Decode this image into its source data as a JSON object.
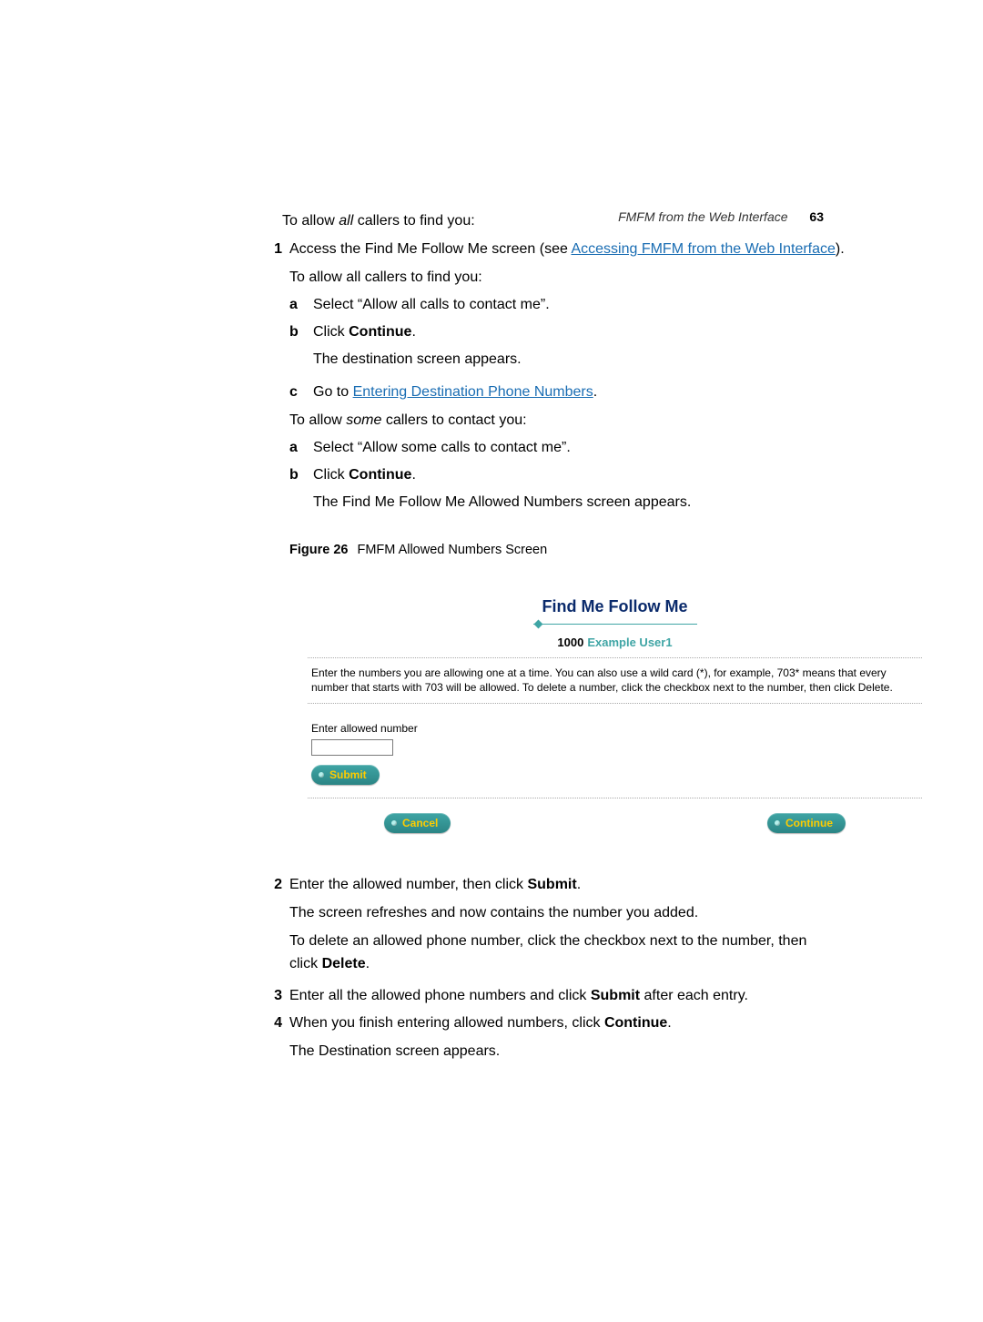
{
  "header": {
    "section": "FMFM from the Web Interface",
    "page": "63"
  },
  "intro": {
    "lead_pre": "To allow ",
    "lead_em": "all",
    "lead_post": " callers to find you:"
  },
  "step1": {
    "num": "1",
    "text_pre": "Access the Find Me Follow Me screen (see ",
    "link1": "Accessing FMFM from the Web Interface",
    "text_post": ")."
  },
  "reintro_all": "To allow all callers to find you:",
  "sub_a1": {
    "label": "a",
    "text": "Select “Allow all calls to contact me”."
  },
  "sub_b1": {
    "label": "b",
    "pre": "Click ",
    "bold": "Continue",
    "post": ".",
    "after": "The destination screen appears."
  },
  "sub_c1": {
    "label": "c",
    "pre": "Go to ",
    "link": "Entering Destination Phone Numbers",
    "post": "."
  },
  "reintro_some": {
    "pre": "To allow ",
    "em": "some",
    "post": " callers to contact you:"
  },
  "sub_a2": {
    "label": "a",
    "text": "Select “Allow some calls to contact me”."
  },
  "sub_b2": {
    "label": "b",
    "pre": "Click ",
    "bold": "Continue",
    "post": ".",
    "after": "The Find Me Follow Me Allowed Numbers screen appears."
  },
  "figure": {
    "label": "Figure 26",
    "caption": "FMFM Allowed Numbers Screen"
  },
  "ui": {
    "title": "Find Me Follow Me",
    "uid": "1000",
    "uname": "Example User1",
    "instructions": "Enter the numbers you are allowing one at a time. You can also use a wild card (*), for example, 703* means that every number that starts with 703 will be allowed. To delete a number, click the checkbox next to the number, then click Delete.",
    "field_label": "Enter allowed number",
    "input_value": "",
    "submit": "Submit",
    "cancel": "Cancel",
    "continue": "Continue"
  },
  "step2": {
    "num": "2",
    "line1_pre": "Enter the allowed number, then click ",
    "line1_bold": "Submit",
    "line1_post": ".",
    "line2": "The screen refreshes and now contains the number you added.",
    "line3_pre": "To delete an allowed phone number, click the checkbox next to the number, then click ",
    "line3_bold": "Delete",
    "line3_post": "."
  },
  "step3": {
    "num": "3",
    "pre": "Enter all the allowed phone numbers and click ",
    "bold": "Submit",
    "post": " after each entry."
  },
  "step4": {
    "num": "4",
    "pre": "When you finish entering allowed numbers, click ",
    "bold": "Continue",
    "post": ".",
    "after": "The Destination screen appears."
  }
}
